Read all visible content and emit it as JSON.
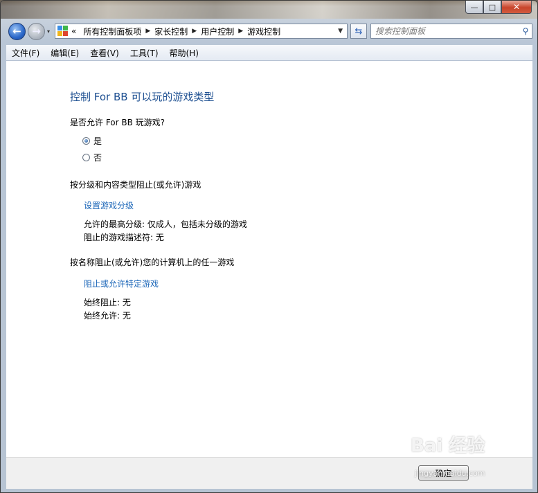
{
  "window": {
    "minimize": "—",
    "maximize": "□",
    "close": "✕"
  },
  "nav": {
    "back_icon": "arrow-left",
    "forward_icon": "arrow-right",
    "recent": "▾",
    "address_prefix": "«",
    "breadcrumbs": [
      "所有控制面板项",
      "家长控制",
      "用户控制",
      "游戏控制"
    ],
    "search_placeholder": "搜索控制面板"
  },
  "menu": [
    "文件(F)",
    "编辑(E)",
    "查看(V)",
    "工具(T)",
    "帮助(H)"
  ],
  "main": {
    "title": "控制 For BB 可以玩的游戏类型",
    "question": "是否允许 For BB 玩游戏?",
    "options": [
      {
        "label": "是",
        "selected": true
      },
      {
        "label": "否",
        "selected": false
      }
    ],
    "rating_section": {
      "heading": "按分级和内容类型阻止(或允许)游戏",
      "link": "设置游戏分级",
      "max_rating": "允许的最高分级:  仅成人，包括未分级的游戏",
      "blocked_descriptors": "阻止的游戏描述符: 无"
    },
    "name_section": {
      "heading": "按名称阻止(或允许)您的计算机上的任一游戏",
      "link": "阻止或允许特定游戏",
      "always_block": "始终阻止: 无",
      "always_allow": "始终允许: 无"
    }
  },
  "footer": {
    "ok": "确定"
  },
  "watermark": {
    "logo": "Bai 经验",
    "url": "jingyan.baidu.com"
  }
}
